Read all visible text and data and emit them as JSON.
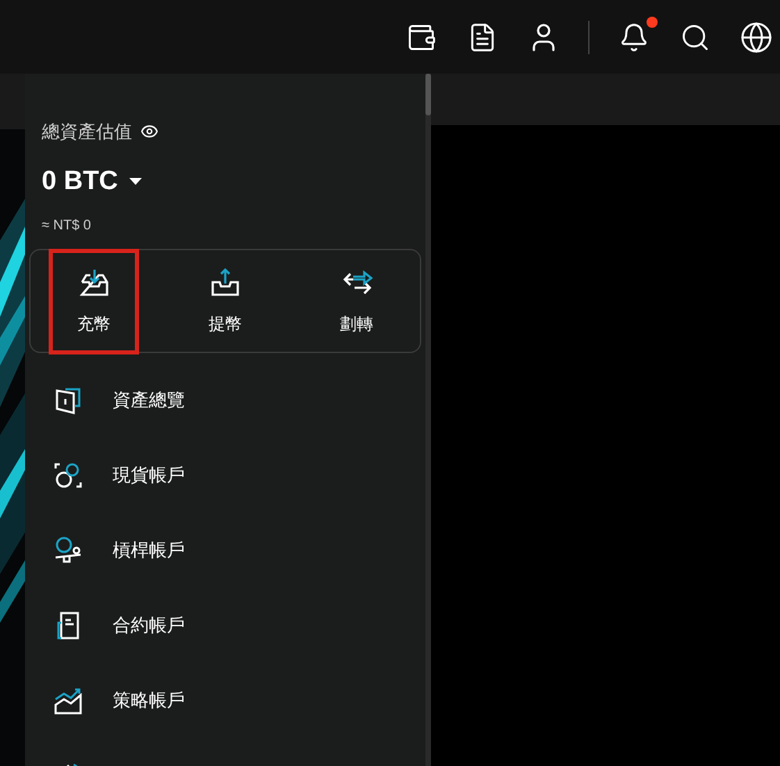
{
  "top_bar": {
    "notifications": {
      "unread": true
    }
  },
  "assets_menu": {
    "title": "總資產估值",
    "amount": "0 BTC",
    "fiat": "≈ NT$ 0",
    "actions": [
      {
        "kind": "deposit",
        "label": "充幣",
        "highlighted": true
      },
      {
        "kind": "withdraw",
        "label": "提幣",
        "highlighted": false
      },
      {
        "kind": "transfer",
        "label": "劃轉",
        "highlighted": false
      }
    ],
    "items": [
      {
        "kind": "overview",
        "label": "資產總覽"
      },
      {
        "kind": "spot",
        "label": "現貨帳戶"
      },
      {
        "kind": "margin",
        "label": "槓桿帳戶"
      },
      {
        "kind": "futures",
        "label": "合約帳戶"
      },
      {
        "kind": "strategy",
        "label": "策略帳戶"
      },
      {
        "kind": "dao"
      }
    ]
  }
}
